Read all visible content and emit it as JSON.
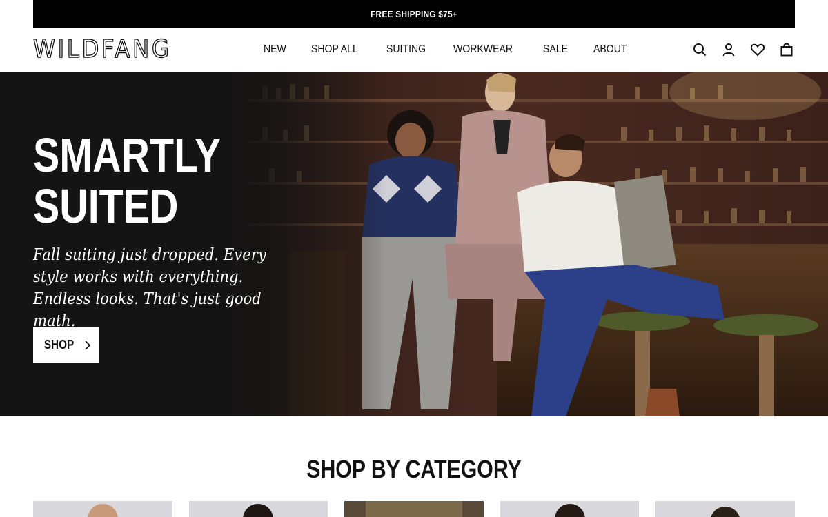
{
  "announcement": {
    "text": "FREE SHIPPING $75+"
  },
  "header": {
    "logo": "WILDFANG",
    "nav": [
      {
        "label": "NEW"
      },
      {
        "label": "SHOP ALL"
      },
      {
        "label": "SUITING"
      },
      {
        "label": "WORKWEAR"
      },
      {
        "label": "SALE"
      },
      {
        "label": "ABOUT"
      }
    ],
    "icons": [
      "search-icon",
      "account-icon",
      "wishlist-heart-icon",
      "cart-bag-icon"
    ]
  },
  "hero": {
    "title_line1": "SMARTLY",
    "title_line2": "SUITED",
    "subtitle": "Fall suiting just dropped. Every style works with everything. Endless looks. That's just good math.",
    "button_label": "SHOP",
    "button_icon": "chevron-right-icon"
  },
  "categories": {
    "title": "SHOP BY CATEGORY",
    "cards": 5
  },
  "colors": {
    "announcement_bg": "#000000",
    "hero_bg": "#141414",
    "text": "#111111",
    "card_bg": "#d9d8dc"
  }
}
